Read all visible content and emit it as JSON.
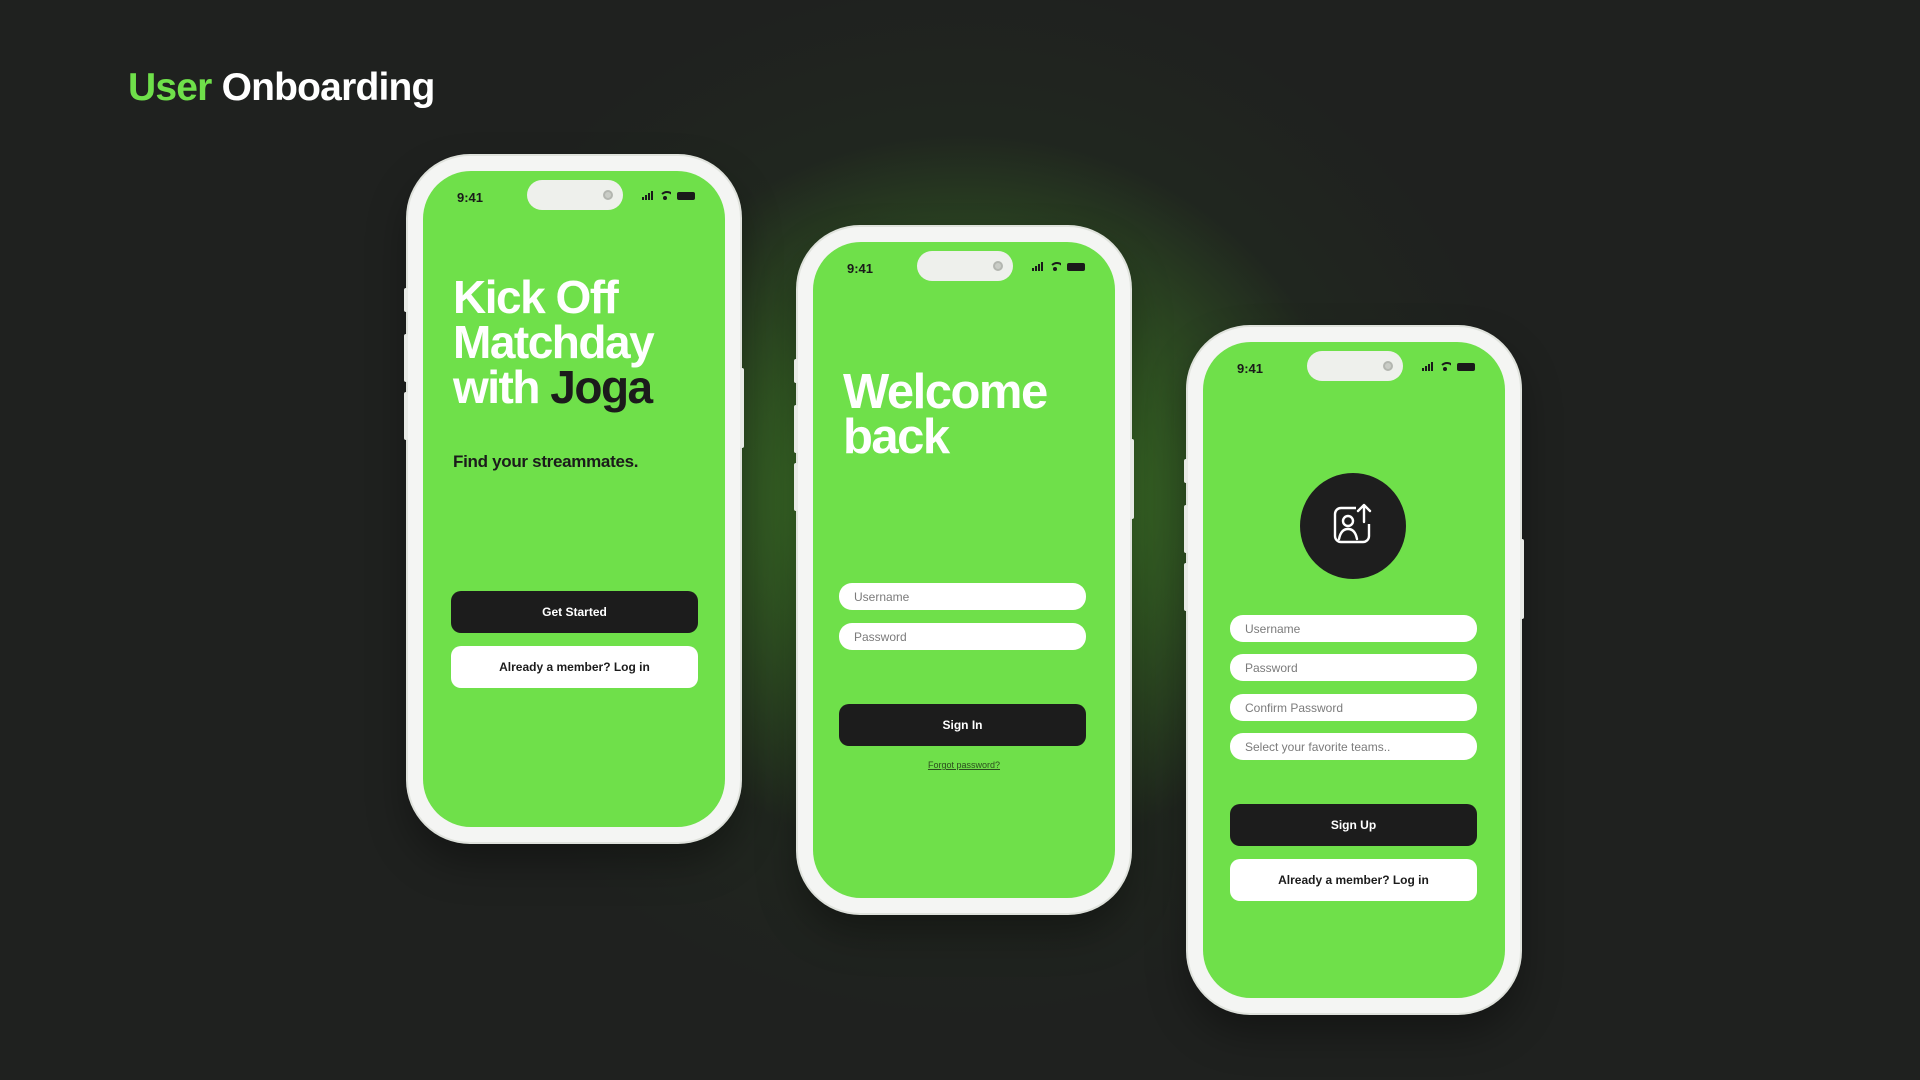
{
  "page": {
    "title_accent": "User",
    "title_rest": "Onboarding"
  },
  "colors": {
    "accent": "#6fe04a",
    "dark": "#1c1c1c",
    "background": "#1f211f"
  },
  "status_bar": {
    "time": "9:41",
    "icons": [
      "signal-icon",
      "wifi-icon",
      "battery-icon"
    ]
  },
  "screen1": {
    "headline_line1": "Kick Off",
    "headline_line2": "Matchday",
    "headline_line3_white": "with",
    "headline_line3_dark": "Joga",
    "subtitle": "Find your streammates.",
    "primary_button": "Get Started",
    "secondary_button": "Already a member? Log in"
  },
  "screen2": {
    "headline_line1": "Welcome",
    "headline_line2": "back",
    "username_placeholder": "Username",
    "password_placeholder": "Password",
    "primary_button": "Sign In",
    "forgot_link": "Forgot password?"
  },
  "screen3": {
    "avatar_icon": "profile-upload-icon",
    "username_placeholder": "Username",
    "password_placeholder": "Password",
    "confirm_password_placeholder": "Confirm Password",
    "teams_placeholder": "Select your favorite teams..",
    "primary_button": "Sign Up",
    "secondary_button": "Already a member? Log in"
  }
}
